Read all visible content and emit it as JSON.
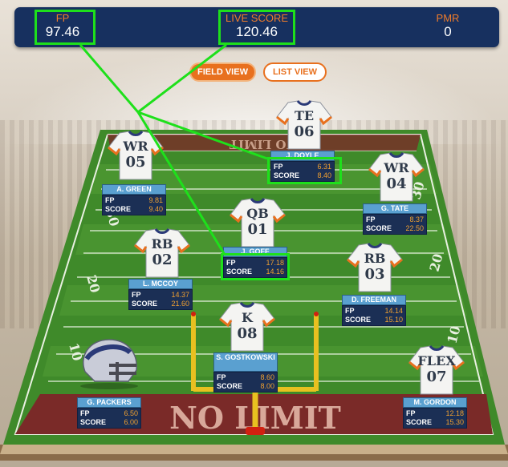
{
  "scoreboard": {
    "fp_label": "FP",
    "fp_value": "97.46",
    "live_label": "LIVE SCORE",
    "live_value": "120.46",
    "pmr_label": "PMR",
    "pmr_value": "0"
  },
  "view_toggle": {
    "field_view": "FIELD VIEW",
    "list_view": "LIST VIEW"
  },
  "field": {
    "endzone_text": "NO LIMIT",
    "far_endzone_text": "NO LIMIT",
    "yard_numbers": [
      "30",
      "20",
      "10",
      "30",
      "20",
      "10"
    ]
  },
  "players": {
    "wr1": {
      "pos": "WR",
      "num": "05",
      "name": "A. GREEN",
      "fp_label": "FP",
      "fp": "9.81",
      "score_label": "SCORE",
      "score": "9.40"
    },
    "te": {
      "pos": "TE",
      "num": "06",
      "name": "J. DOYLE",
      "fp_label": "FP",
      "fp": "6.31",
      "score_label": "SCORE",
      "score": "8.40"
    },
    "wr2": {
      "pos": "WR",
      "num": "04",
      "name": "G. TATE",
      "fp_label": "FP",
      "fp": "8.37",
      "score_label": "SCORE",
      "score": "22.50"
    },
    "qb": {
      "pos": "QB",
      "num": "01",
      "name": "J. GOFF",
      "fp_label": "FP",
      "fp": "17.18",
      "score_label": "SCORE",
      "score": "14.16"
    },
    "rb1": {
      "pos": "RB",
      "num": "02",
      "name": "L. MCCOY",
      "fp_label": "FP",
      "fp": "14.37",
      "score_label": "SCORE",
      "score": "21.60"
    },
    "rb2": {
      "pos": "RB",
      "num": "03",
      "name": "D. FREEMAN",
      "fp_label": "FP",
      "fp": "14.14",
      "score_label": "SCORE",
      "score": "15.10"
    },
    "k": {
      "pos": "K",
      "num": "08",
      "name": "S. GOSTKOWSKI",
      "fp_label": "FP",
      "fp": "8.60",
      "score_label": "SCORE",
      "score": "8.00"
    },
    "def": {
      "name": "G. PACKERS",
      "fp_label": "FP",
      "fp": "6.50",
      "score_label": "SCORE",
      "score": "6.00"
    },
    "flex": {
      "pos": "FLEX",
      "num": "07",
      "name": "M. GORDON",
      "fp_label": "FP",
      "fp": "12.18",
      "score_label": "SCORE",
      "score": "15.30"
    }
  },
  "colors": {
    "accent": "#e8701e",
    "navy": "#17305f",
    "highlight": "#1ee01b",
    "turf": "#3f8a2a"
  }
}
